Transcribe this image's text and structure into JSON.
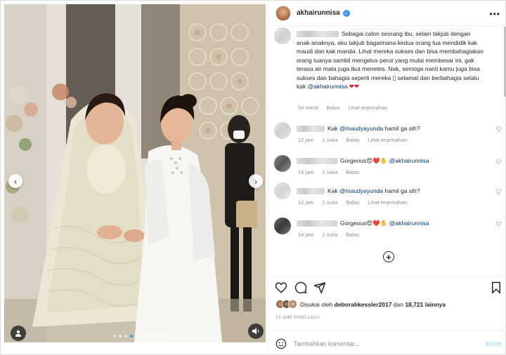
{
  "post": {
    "username": "akhairunnisa",
    "more_label": "•••"
  },
  "comments": [
    {
      "id": "c1",
      "text": "Sebagai calon seorang ibu, selain takjub dengan anak-anaknya, aku takjub bagaimana kedua orang tua mendidik kak maudi dan kak manda. Lihat mereka sukses dan bisa membahagiakan orang tuanya sambil mengelus perut yang mulai membesar ini, gak terasa air mata juga ikut menetes. Nak, semoga nanti kamu juga bisa sukses dan bahagia seperti mereka ",
      "mention": "@akhairunnisa",
      "text_tail": " selamat dan berbahagia selalu kak ",
      "meta_time": "54 menit",
      "meta_reply": "Balas",
      "meta_translate": "Lihat terjemahan"
    },
    {
      "id": "c2",
      "prefix": "Kak ",
      "mention": "@maudyayunda",
      "suffix": " hamil ga sih?",
      "meta_time": "12 jam",
      "meta_likes": "1 suka",
      "meta_reply": "Balas",
      "meta_translate": "Lihat terjemahan"
    },
    {
      "id": "c3",
      "prefix": "Gorgeous",
      "emoji": "😍❤️✋",
      "mention": "@akhairunnisa",
      "meta_time": "14 jam",
      "meta_likes": "1 suka",
      "meta_reply": "Balas"
    },
    {
      "id": "c4",
      "prefix": "Kak ",
      "mention": "@maudyayunda",
      "suffix": " hamil ga sih?",
      "meta_time": "12 jam",
      "meta_likes": "1 suka",
      "meta_reply": "Balas",
      "meta_translate": "Lihat terjemahan"
    },
    {
      "id": "c5",
      "prefix": "Gorgeous",
      "emoji": "😍❤️✋",
      "mention": "@akhairunnisa",
      "meta_time": "14 jam",
      "meta_likes": "1 suka",
      "meta_reply": "Balas"
    }
  ],
  "likes": {
    "prefix": "Disukai oleh ",
    "user": "deborahkessler2017",
    "middle": " dan ",
    "count": "18,721 lainnya"
  },
  "timestamp": "15 JAM YANG LALU",
  "add_comment": {
    "placeholder": "Tambahkan komentar...",
    "post_label": "Kirim"
  },
  "icons": {
    "nav_prev": "chevron-left-icon",
    "nav_next": "chevron-right-icon",
    "heart": "heart-icon",
    "comment": "comment-icon",
    "share": "share-icon",
    "save": "bookmark-icon",
    "emoji": "emoji-icon",
    "load_more": "plus-circle-icon"
  },
  "colors": {
    "accent": "#3897f0",
    "mention": "#00376b",
    "muted": "#8e8e8e"
  }
}
